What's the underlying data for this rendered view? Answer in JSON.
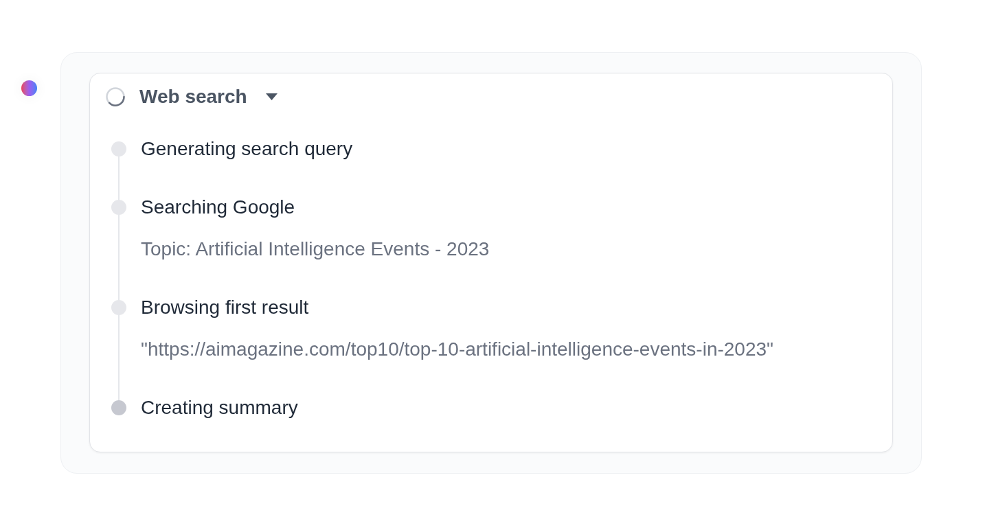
{
  "web_search": {
    "title": "Web search",
    "expanded": true,
    "in_progress": true,
    "steps": [
      {
        "title": "Generating search query",
        "current": false
      },
      {
        "title": "Searching Google",
        "detail": "Topic: Artificial Intelligence Events - 2023",
        "current": false
      },
      {
        "title": "Browsing first result",
        "detail": "\"https://aimagazine.com/top10/top-10-artificial-intelligence-events-in-2023\"",
        "current": false
      },
      {
        "title": "Creating summary",
        "current": true
      }
    ]
  }
}
